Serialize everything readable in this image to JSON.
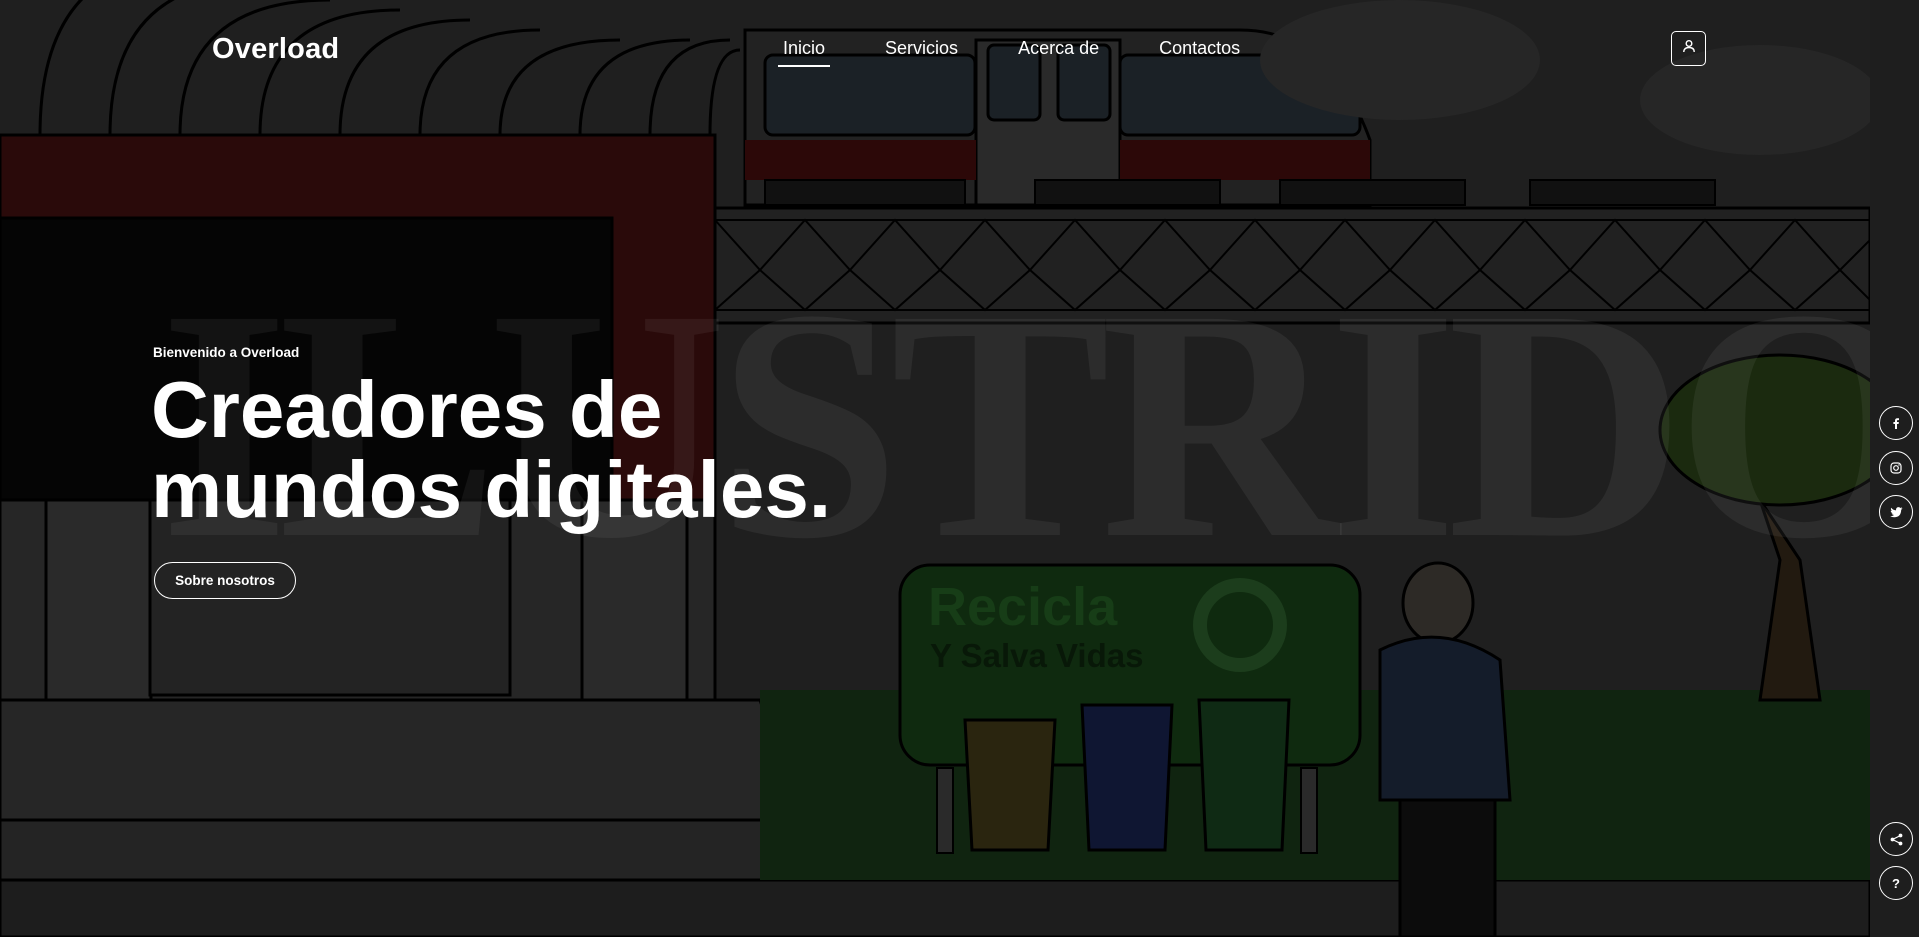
{
  "header": {
    "logo": "Overload",
    "nav": [
      {
        "label": "Inicio",
        "active": true
      },
      {
        "label": "Servicios",
        "active": false
      },
      {
        "label": "Acerca de",
        "active": false
      },
      {
        "label": "Contactos",
        "active": false
      }
    ],
    "user_icon": "user-icon"
  },
  "hero": {
    "welcome": "Bienvenido a Overload",
    "headline_line1": "Creadores de",
    "headline_line2": "mundos digitales.",
    "button_label": "Sobre nosotros",
    "illustration": {
      "watermark_text": "ILUSTRIDO",
      "sign_title": "Recicla",
      "sign_subtitle": "Y Salva Vidas"
    }
  },
  "social": {
    "items": [
      "facebook-icon",
      "instagram-icon",
      "twitter-icon"
    ],
    "bottom": [
      "share-icon",
      "help-icon"
    ]
  },
  "colors": {
    "background": "#1a1a1a",
    "text": "#ffffff"
  }
}
